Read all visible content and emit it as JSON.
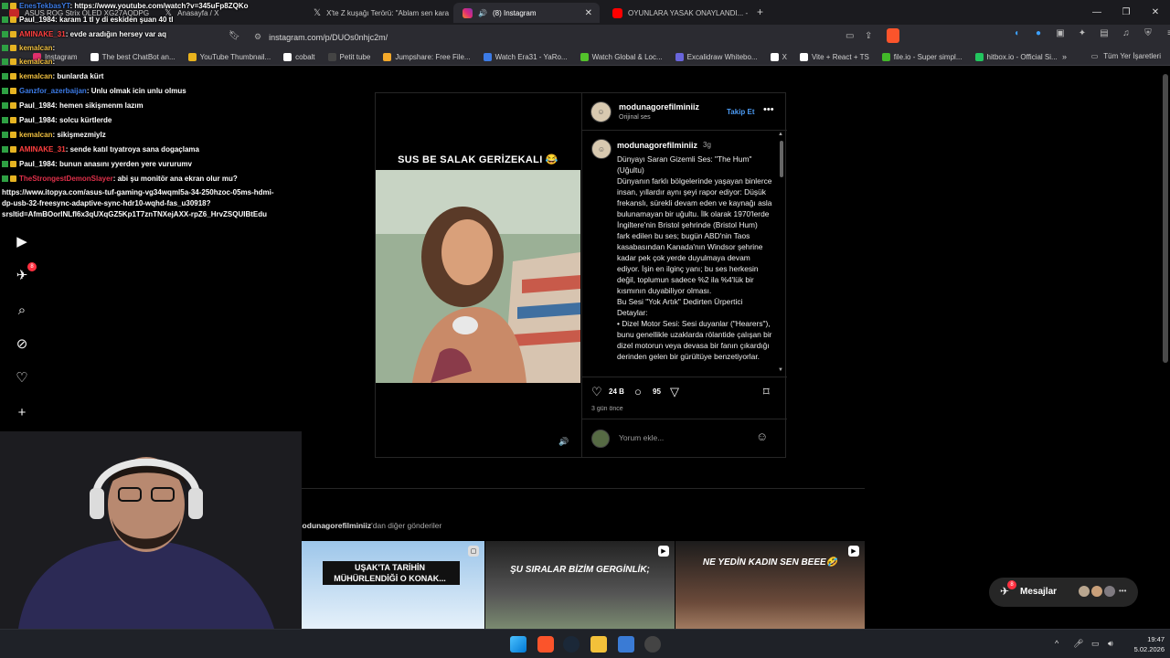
{
  "tabs": [
    {
      "label": "ASUS ROG Strix OLED XG27AQDPG",
      "active": false
    },
    {
      "label": "Anasayfa / X",
      "active": false
    },
    {
      "label": "X'te Z kuşağı Terörü: \"Ablam sen kara",
      "active": false
    },
    {
      "label": "(8) Instagram",
      "active": true
    },
    {
      "label": "OYUNLARA YASAK ONAYLANDI... - Y",
      "active": false
    }
  ],
  "address": {
    "url": "instagram.com/p/DUOs0nhjc2m/"
  },
  "bookmarks": [
    {
      "label": "Instagram",
      "color": "#e1306c"
    },
    {
      "label": "The best ChatBot an...",
      "color": "#ffffff"
    },
    {
      "label": "YouTube Thumbnail...",
      "color": "#e9b31d"
    },
    {
      "label": "cobalt",
      "color": "#ffffff"
    },
    {
      "label": "Petit tube",
      "color": "#444444"
    },
    {
      "label": "Jumpshare: Free File...",
      "color": "#f4a92a"
    },
    {
      "label": "Watch Era31 - YaRo...",
      "color": "#3c7be6"
    },
    {
      "label": "Watch Global & Loc...",
      "color": "#53c22b"
    },
    {
      "label": "Excalidraw Whitebo...",
      "color": "#6965db"
    },
    {
      "label": "X",
      "color": "#ffffff"
    },
    {
      "label": "Vite + React + TS",
      "color": "#ffffff"
    },
    {
      "label": "file.io - Super simpl...",
      "color": "#42b829"
    },
    {
      "label": "hitbox.io - Official Si...",
      "color": "#22c55e"
    }
  ],
  "bookmarks_all": "Tüm Yer İşaretleri",
  "chat": [
    {
      "user": "EnesTekbasYT",
      "text": ": https://www.youtube.com/watch?v=345uFp8ZQKo",
      "color": "#3c7be6"
    },
    {
      "user": "Paul_1984",
      "text": ": karam 1 tl y di eskiden şuan 40 tl",
      "color": "#ffffff"
    },
    {
      "user": "AMINAKE_31",
      "text": ": evde aradığın hersey var aq",
      "color": "#ff4040"
    },
    {
      "user": "kemalcan",
      "text": ":",
      "color": "#f0c040"
    },
    {
      "user": "kemalcan",
      "text": ":",
      "color": "#f0c040"
    },
    {
      "user": "kemalcan",
      "text": ": bunlarda kürt",
      "color": "#f0c040"
    },
    {
      "user": "Ganzfor_azerbaijan",
      "text": ": Unlu olmak icin unlu olmus",
      "color": "#3c7be6"
    },
    {
      "user": "Paul_1984",
      "text": ": hemen sikişmenm lazım",
      "color": "#ffffff"
    },
    {
      "user": "Paul_1984",
      "text": ": solcu kürtlerde",
      "color": "#ffffff"
    },
    {
      "user": "kemalcan",
      "text": ": sikişmezmiylz",
      "color": "#f0c040"
    },
    {
      "user": "AMINAKE_31",
      "text": ": sende katıl tıyatroya sana dogaçlama",
      "color": "#ff4040"
    },
    {
      "user": "Paul_1984",
      "text": ": bunun anasını yyerden yere vururumv",
      "color": "#ffffff"
    },
    {
      "user": "TheStrongestDemonSlayer",
      "text": ": abi şu monitör ana ekran olur mu?",
      "color": "#e0304a"
    }
  ],
  "chat_link": [
    "https://www.itopya.com/asus-tuf-gaming-vg34wqml5a-34-250hzoc-05ms-hdmi-",
    "dp-usb-32-freesync-adaptive-sync-hdr10-wqhd-fas_u30918?",
    "srsltid=AfmBOorINLfI6x3qUXqGZ5Kp1T7znTNXejAXX-rpZ6_HrvZSQUIBtEdu"
  ],
  "sidebar": {
    "notif_count": "8"
  },
  "post": {
    "overlay_text": "SUS BE SALAK GERİZEKALI 😂",
    "username": "modunagorefilminiiz",
    "audio": "Orijinal ses",
    "follow": "Takip Et",
    "caption_user": "modunagorefilminiiz",
    "caption_time": "3g",
    "caption": "Dünyayı Saran Gizemli Ses: \"The Hum\" (Uğultu)\nDünyanın farklı bölgelerinde yaşayan binlerce insan, yıllardır aynı şeyi rapor ediyor: Düşük frekanslı, sürekli devam eden ve kaynağı asla bulunamayan bir uğultu. İlk olarak 1970'lerde İngiltere'nin Bristol şehrinde (Bristol Hum) fark edilen bu ses; bugün ABD'nin Taos kasabasından Kanada'nın Windsor şehrine kadar pek çok yerde duyulmaya devam ediyor. İşin en ilginç yanı; bu ses herkesin değil, toplumun sadece %2 ila %4'lük bir kısmının duyabiliyor olması.\nBu Sesi \"Yok Artık\" Dedirten Ürpertici Detaylar:\n• Dizel Motor Sesi: Sesi duyanlar (\"Hearers\"), bunu genellikle uzaklarda rölantide çalışan bir dizel motorun veya devasa bir fanın çıkardığı derinden gelen bir gürültüye benzetiyorlar.",
    "likes": "24 B",
    "comments": "95",
    "time_ago": "3 gün önce",
    "comment_placeholder": "Yorum ekle..."
  },
  "more": {
    "user": "modunagorefilminiiz",
    "suffix": "'dan diğer gönderiler",
    "thumbs": [
      {
        "label": "UŞAK'TA TARİHİN MÜHÜRLENDİĞİ O KONAK..."
      },
      {
        "label": "ŞU SIRALAR BİZİM GERGİNLİK;"
      },
      {
        "label": "NE YEDİN KADIN SEN BEEE🤣"
      }
    ]
  },
  "messages": {
    "label": "Mesajlar",
    "count": "8"
  },
  "clock": {
    "time": "19:47",
    "date": "5.02.2026"
  }
}
